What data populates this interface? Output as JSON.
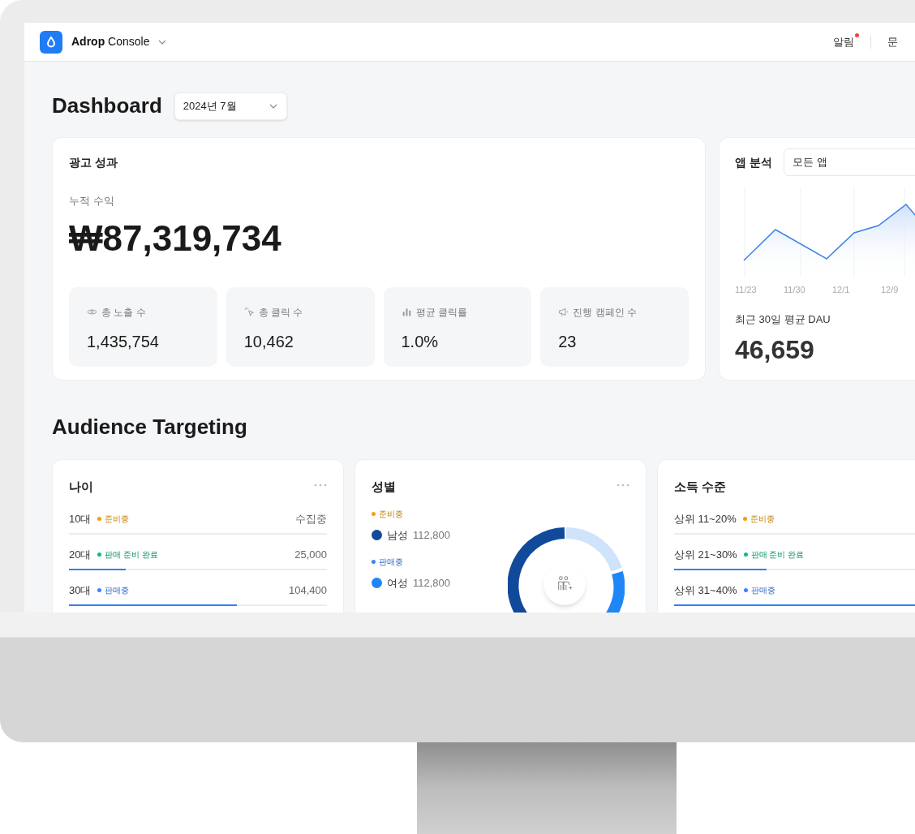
{
  "header": {
    "brand": "Adrop",
    "product": "Console",
    "links": [
      {
        "label": "알림",
        "badge": true
      },
      {
        "label": "문",
        "badge": false
      }
    ]
  },
  "dashboard": {
    "title": "Dashboard",
    "period": "2024년 7월"
  },
  "ad_performance": {
    "title": "광고 성과",
    "revenue_label": "누적 수익",
    "revenue": "₩87,319,734",
    "stats": [
      {
        "kind": "impressions",
        "label": "총 노출 수",
        "value": "1,435,754"
      },
      {
        "kind": "clicks",
        "label": "총 클릭 수",
        "value": "10,462"
      },
      {
        "kind": "ctr",
        "label": "평균 클릭률",
        "value": "1.0%"
      },
      {
        "kind": "campaigns",
        "label": "진행 캠페인 수",
        "value": "23"
      }
    ]
  },
  "app_analytics": {
    "title": "앱 분석",
    "app_select": "모든 앱",
    "x_labels": [
      "11/23",
      "11/30",
      "12/1",
      "12/9"
    ],
    "metric_label": "최근 30일 평균 DAU",
    "metric_value": "46,659"
  },
  "audience": {
    "title": "Audience Targeting",
    "age": {
      "title": "나이",
      "rows": [
        {
          "label": "10대",
          "status": {
            "label": "준비중",
            "color": "#f59e0b"
          },
          "value": "수집중"
        },
        {
          "label": "20대",
          "status": {
            "label": "판매 준비 완료",
            "color": "#10b981"
          },
          "value": "25,000",
          "level": 0.22
        },
        {
          "label": "30대",
          "status": {
            "label": "판매중",
            "color": "#3b82f6"
          },
          "value": "104,400",
          "level": 0.65
        }
      ]
    },
    "gender": {
      "title": "성별",
      "items": [
        {
          "status": {
            "label": "준비중",
            "color": "#f59e0b"
          },
          "label": "남성",
          "color": "#114a9a",
          "value": "112,800"
        },
        {
          "status": {
            "label": "판매중",
            "color": "#3b82f6"
          },
          "label": "여성",
          "color": "#1f86f5",
          "value": "112,800"
        }
      ]
    },
    "income": {
      "title": "소득 수준",
      "rows": [
        {
          "label": "상위 11~20%",
          "status": {
            "label": "준비중",
            "color": "#f59e0b"
          }
        },
        {
          "label": "상위 21~30%",
          "status": {
            "label": "판매 준비 완료",
            "color": "#10b981"
          },
          "level": 0.36
        },
        {
          "label": "상위 31~40%",
          "status": {
            "label": "판매중",
            "color": "#3b82f6"
          },
          "level": 1
        }
      ]
    }
  }
}
